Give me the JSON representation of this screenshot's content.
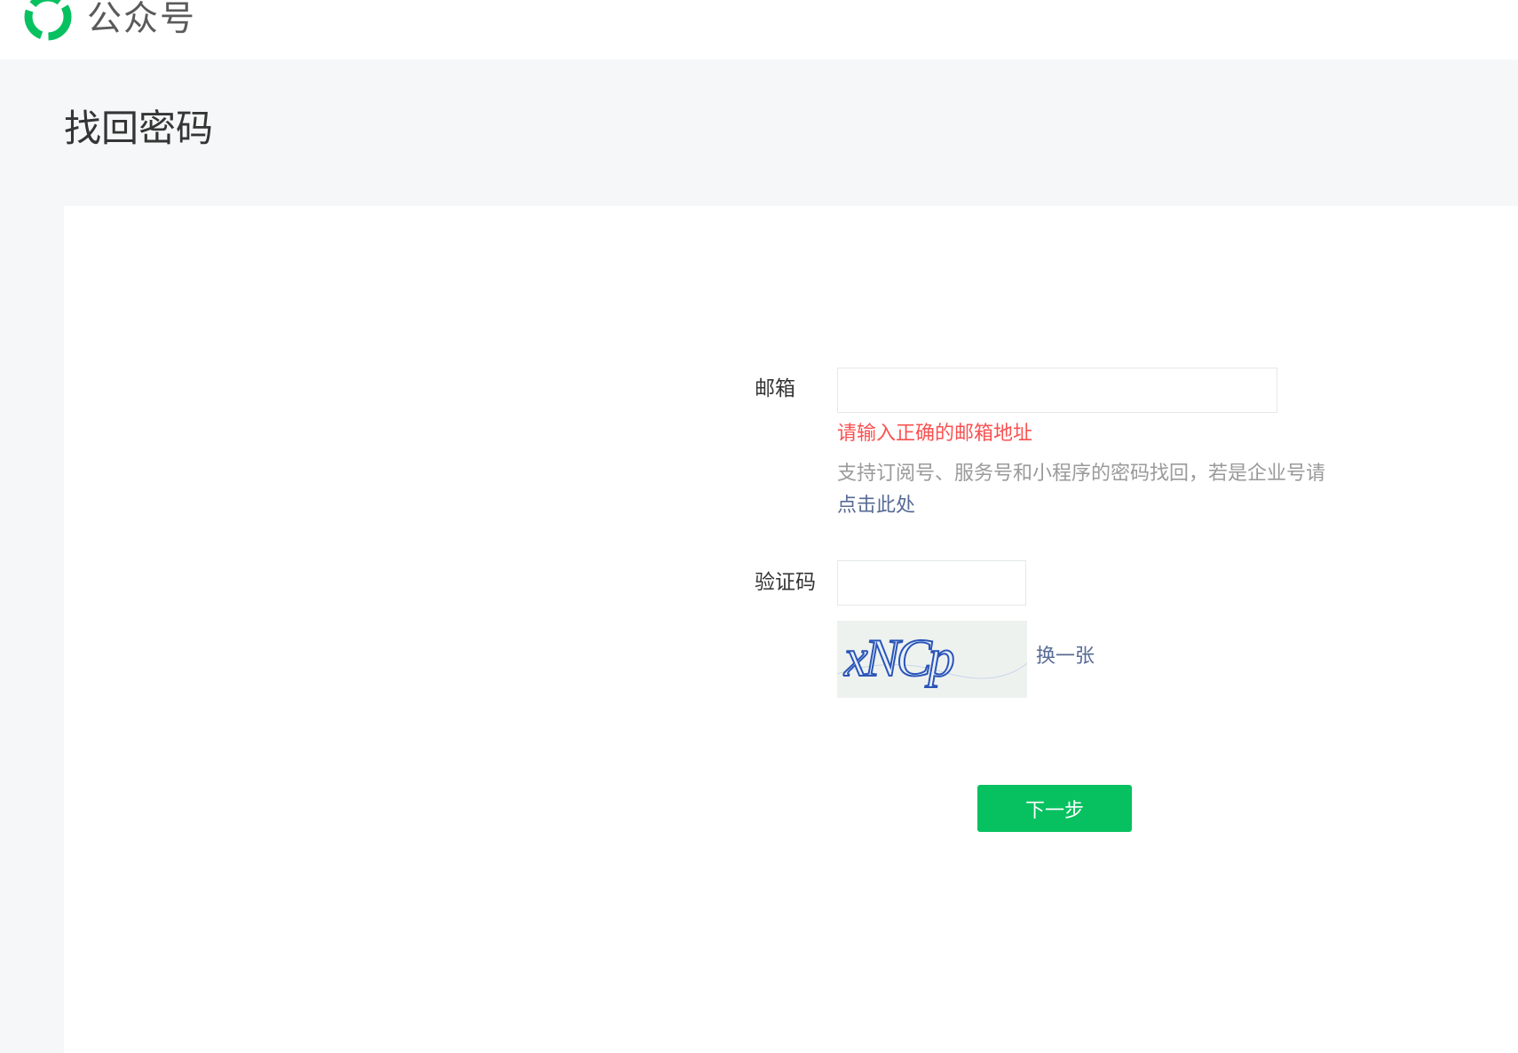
{
  "header": {
    "brand": "公众号",
    "logo_icon": "wechat-official-account-logo-icon",
    "brand_color": "#07c160"
  },
  "page": {
    "title": "找回密码"
  },
  "form": {
    "email_label": "邮箱",
    "email_value": "",
    "email_error": "请输入正确的邮箱地址",
    "tip_text": "支持订阅号、服务号和小程序的密码找回，若是企业号请",
    "tip_link": "点击此处",
    "captcha_label": "验证码",
    "captcha_value": "",
    "captcha_text": "xNCp",
    "refresh_label": "换一张",
    "next_button": "下一步"
  },
  "colors": {
    "accent": "#07c160",
    "error": "#fa5151",
    "link": "#576b95"
  }
}
